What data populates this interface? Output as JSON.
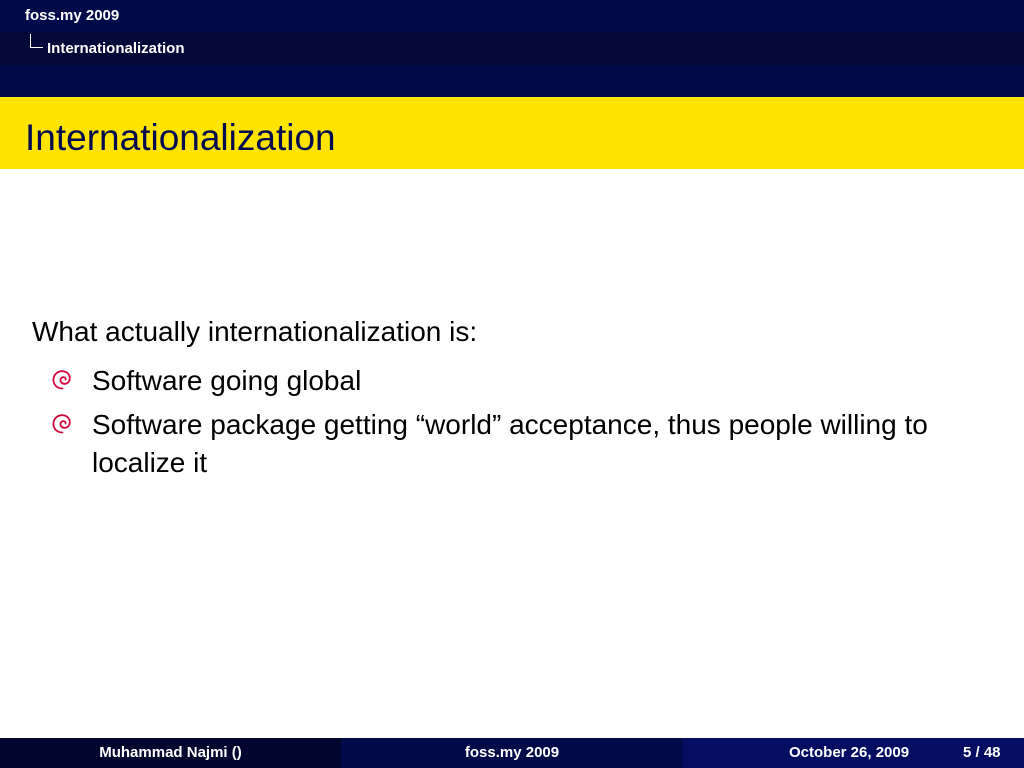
{
  "header": {
    "title": "foss.my 2009",
    "section": "Internationalization"
  },
  "frame": {
    "title": "Internationalization"
  },
  "body": {
    "intro": "What actually internationalization is:",
    "bullets": [
      {
        "text": "Software going global",
        "icon": "debian-swirl-icon"
      },
      {
        "text": "Software package getting “world” acceptance, thus people willing to localize it",
        "icon": "debian-swirl-icon"
      }
    ]
  },
  "footer": {
    "author": "Muhammad Najmi ()",
    "event": "foss.my 2009",
    "date": "October 26, 2009",
    "page": "5 / 48"
  },
  "colors": {
    "navy": "#030a4a",
    "dark_navy": "#02062f",
    "title_bar": "#ffe400",
    "title_text": "#050a50",
    "bullet_red": "#d10a3a"
  }
}
